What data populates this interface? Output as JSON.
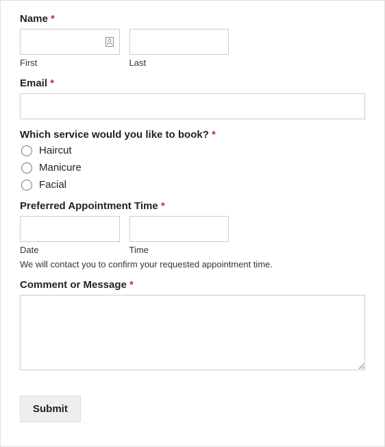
{
  "name": {
    "label": "Name",
    "required_mark": "*",
    "first_sublabel": "First",
    "last_sublabel": "Last",
    "first_value": "",
    "last_value": ""
  },
  "email": {
    "label": "Email",
    "required_mark": "*",
    "value": ""
  },
  "service": {
    "label": "Which service would you like to book?",
    "required_mark": "*",
    "options": {
      "haircut": "Haircut",
      "manicure": "Manicure",
      "facial": "Facial"
    }
  },
  "appointment": {
    "label": "Preferred Appointment Time",
    "required_mark": "*",
    "date_sublabel": "Date",
    "time_sublabel": "Time",
    "date_value": "",
    "time_value": "",
    "description": "We will contact you to confirm your requested appointment time."
  },
  "comment": {
    "label": "Comment or Message",
    "required_mark": "*",
    "value": ""
  },
  "submit": {
    "label": "Submit"
  }
}
